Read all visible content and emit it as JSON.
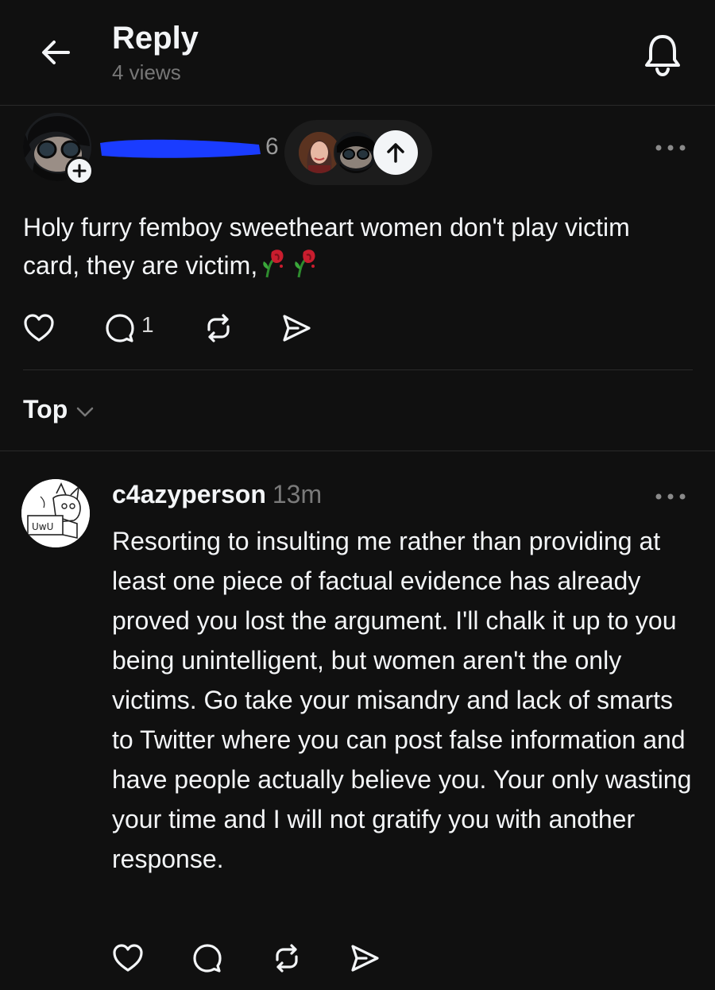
{
  "header": {
    "title": "Reply",
    "views": "4 views"
  },
  "parent_post": {
    "author_visible_suffix": "6",
    "text": "Holy furry femboy sweetheart women don't play victim card, they are victim,",
    "emoji_count": 2,
    "reply_count": "1",
    "redaction_color": "#1a3cff"
  },
  "sort": {
    "label": "Top"
  },
  "reply": {
    "username": "c4azyperson",
    "time": "13m",
    "avatar_sign_text": "UwU",
    "body": "Resorting to insulting me rather than providing at least one piece of factual evidence has already proved you lost the argument. I'll chalk it up to you being unintelligent, but women aren't the only victims. Go take your misandry and lack of smarts to Twitter where you can post false information and have people actually believe you. Your only wasting your time and I will not gratify you with another response."
  },
  "icons": {
    "back": "arrow-left-icon",
    "bell": "bell-icon",
    "plus": "plus-icon",
    "up": "arrow-up-icon",
    "more": "more-horizontal-icon",
    "like": "heart-icon",
    "reply": "comment-icon",
    "repost": "repost-icon",
    "share": "send-icon",
    "chevron": "chevron-down-icon",
    "rose": "wilted-rose-icon"
  },
  "colors": {
    "background": "#101010",
    "text": "#f3f5f7",
    "muted": "#777777",
    "divider": "#2a2a2a"
  }
}
